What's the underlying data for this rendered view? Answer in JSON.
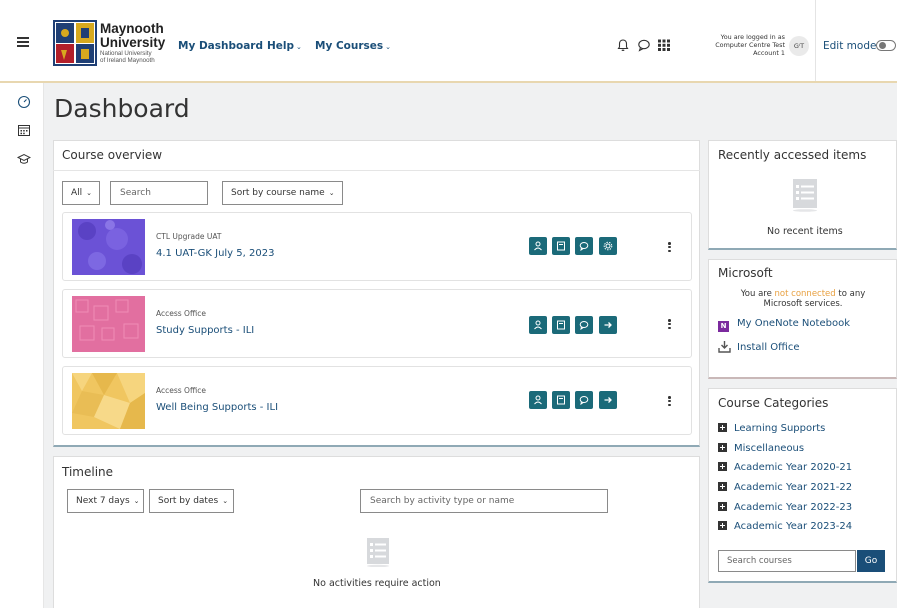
{
  "nav": {
    "logo_line1": "Maynooth",
    "logo_line2": "University",
    "logo_line3": "National University",
    "logo_line4": "of Ireland Maynooth",
    "links": [
      {
        "label": "My Dashboard",
        "chevron": ""
      },
      {
        "label": "Help",
        "chevron": "⌄"
      },
      {
        "label": "My Courses",
        "chevron": "⌄"
      }
    ],
    "login_line1": "You are logged in as",
    "login_line2": "Computer Centre Test",
    "login_line3": "Account 1",
    "avatar_initials": "GⁱT",
    "edit_mode": "Edit mode"
  },
  "page": {
    "title": "Dashboard"
  },
  "course_overview": {
    "title": "Course overview",
    "filter": "All",
    "search_placeholder": "Search",
    "sort": "Sort by course name",
    "courses": [
      {
        "category": "CTL Upgrade UAT",
        "name": "4.1 UAT-GK July 5, 2023"
      },
      {
        "category": "Access Office",
        "name": "Study Supports - ILI"
      },
      {
        "category": "Access Office",
        "name": "Well Being Supports - ILI"
      }
    ]
  },
  "timeline": {
    "title": "Timeline",
    "range": "Next 7 days",
    "sort": "Sort by dates",
    "search_placeholder": "Search by activity type or name",
    "empty": "No activities require action"
  },
  "recent": {
    "title": "Recently accessed items",
    "empty": "No recent items"
  },
  "microsoft": {
    "title": "Microsoft",
    "status_prefix": "You are",
    "status_link": "not connected",
    "status_suffix": "to any",
    "status_line2": "Microsoft services.",
    "onenote": "My OneNote Notebook",
    "install": "Install Office"
  },
  "categories": {
    "title": "Course Categories",
    "items": [
      "Learning Supports",
      "Miscellaneous",
      "Academic Year 2020-21",
      "Academic Year 2021-22",
      "Academic Year 2022-23",
      "Academic Year 2023-24"
    ],
    "search_placeholder": "Search courses",
    "go": "Go"
  },
  "colors": {
    "accent": "#1a4e78",
    "course_button": "#1b6a79",
    "not_connected": "#e8a040"
  }
}
